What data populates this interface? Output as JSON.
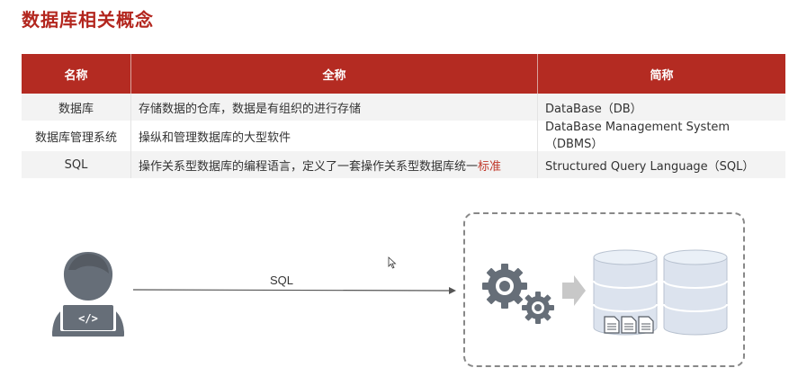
{
  "page": {
    "title": "数据库相关概念"
  },
  "table": {
    "headers": [
      "名称",
      "全称",
      "简称"
    ],
    "rows": [
      {
        "name": "数据库",
        "full": "存储数据的仓库，数据是有组织的进行存储",
        "full_highlight": "",
        "abbr": "DataBase（DB）"
      },
      {
        "name": "数据库管理系统",
        "full": "操纵和管理数据库的大型软件",
        "full_highlight": "",
        "abbr": "DataBase Management System（DBMS）"
      },
      {
        "name": "SQL",
        "full": "操作关系型数据库的编程语言，定义了一套操作关系型数据库统一",
        "full_highlight": "标准",
        "abbr": "Structured Query Language（SQL）"
      }
    ]
  },
  "diagram": {
    "arrow_label": "SQL",
    "icons": [
      "user-with-laptop-icon",
      "gears-icon",
      "right-arrow-icon",
      "database-icon",
      "database-icon",
      "documents-icon"
    ],
    "colors": {
      "icon": "#666e78",
      "db_light": "#dce3ee",
      "db_stroke": "#b8c2d0",
      "arrow": "#c8c8c8",
      "accent": "#b42b22"
    }
  }
}
